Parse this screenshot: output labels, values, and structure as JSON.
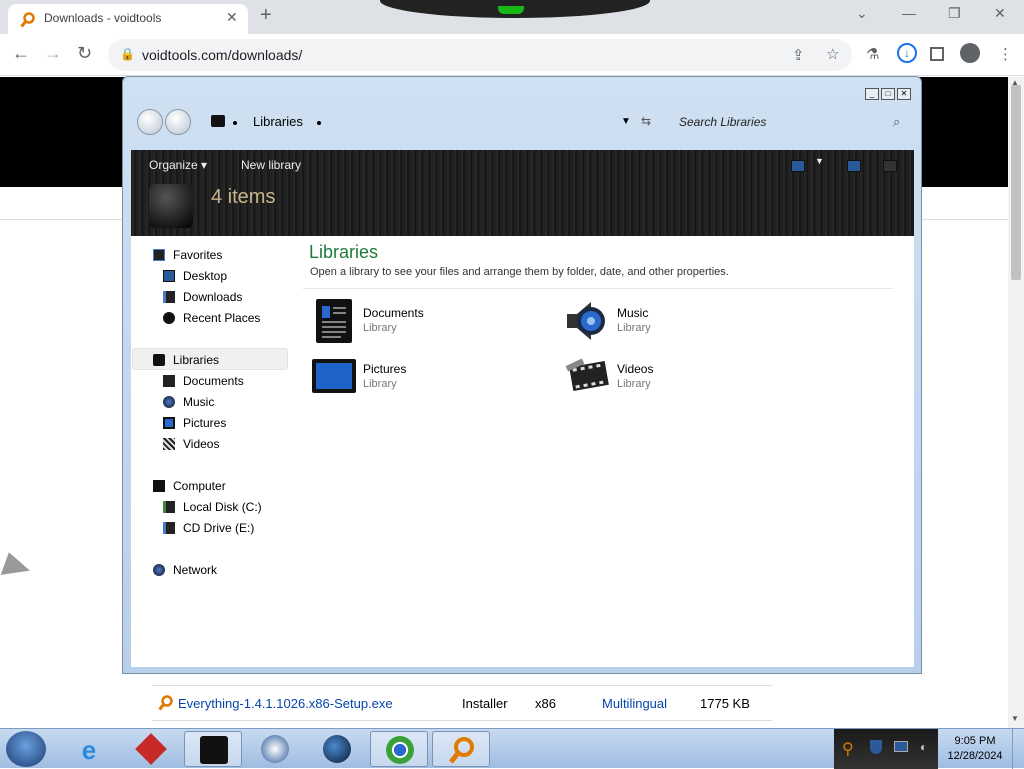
{
  "browser": {
    "tab_title": "Downloads - voidtools",
    "tab_close": "✕",
    "new_tab": "+",
    "window_buttons": [
      "⌄",
      "—",
      "❐",
      "✕"
    ],
    "url": "voidtools.com/downloads/",
    "nav": {
      "back": "←",
      "forward": "→",
      "reload": "↻"
    },
    "toolbar_icons": [
      "share-icon",
      "star-icon",
      "lab-icon",
      "download-icon",
      "sidepanel-icon",
      "profile-icon",
      "menu-icon"
    ]
  },
  "page": {
    "download_row": {
      "filename": "Everything-1.4.1.1026.x86-Setup.exe",
      "type": "Installer",
      "arch": "x86",
      "language": "Multilingual",
      "size": "1775 KB"
    }
  },
  "explorer": {
    "breadcrumb": "Libraries",
    "search_placeholder": "Search Libraries",
    "commands": {
      "organize": "Organize ▾",
      "new_library": "New library"
    },
    "item_count": "4 items",
    "nav_pane": {
      "favorites": {
        "label": "Favorites",
        "items": [
          "Desktop",
          "Downloads",
          "Recent Places"
        ]
      },
      "libraries": {
        "label": "Libraries",
        "items": [
          "Documents",
          "Music",
          "Pictures",
          "Videos"
        ]
      },
      "computer": {
        "label": "Computer",
        "items": [
          "Local Disk (C:)",
          "CD Drive (E:)"
        ]
      },
      "network": {
        "label": "Network"
      }
    },
    "content": {
      "title": "Libraries",
      "description": "Open a library to see your files and arrange them by folder, date, and other properties.",
      "libraries": [
        {
          "name": "Documents",
          "type": "Library",
          "icon": "documents-icon"
        },
        {
          "name": "Music",
          "type": "Library",
          "icon": "speaker-icon"
        },
        {
          "name": "Pictures",
          "type": "Library",
          "icon": "picture-icon"
        },
        {
          "name": "Videos",
          "type": "Library",
          "icon": "film-icon"
        }
      ]
    }
  },
  "taskbar": {
    "time": "9:05 PM",
    "date": "12/28/2024",
    "apps": [
      "internet-explorer-icon",
      "app-red-icon",
      "explorer-icon",
      "media-player-icon",
      "globe-icon",
      "chrome-icon",
      "everything-icon"
    ]
  }
}
